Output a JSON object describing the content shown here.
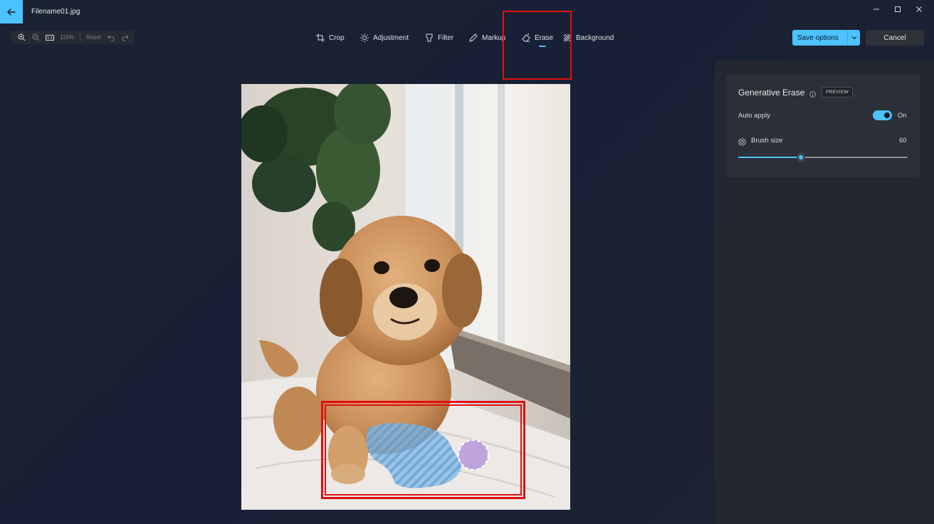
{
  "titlebar": {
    "filename": "Filename01.jpg",
    "icons": [
      "back-arrow-icon",
      "minimize-icon",
      "maximize-icon",
      "close-icon"
    ]
  },
  "zoom": {
    "level": "110%",
    "reset_label": "Reset",
    "icons": [
      "zoom-in-icon",
      "zoom-out-icon",
      "actual-size-icon",
      "undo-icon",
      "redo-icon"
    ]
  },
  "toolbar": {
    "active_tool": "Erase",
    "tools": [
      {
        "label": "Crop",
        "icon": "crop-icon"
      },
      {
        "label": "Adjustment",
        "icon": "brightness-icon"
      },
      {
        "label": "Filter",
        "icon": "filter-icon"
      },
      {
        "label": "Markup",
        "icon": "pen-icon"
      },
      {
        "label": "Erase",
        "icon": "eraser-icon"
      },
      {
        "label": "Background",
        "icon": "background-icon"
      }
    ],
    "save_label": "Save options",
    "cancel_label": "Cancel"
  },
  "panel": {
    "title": "Generative Erase",
    "badge": "PREVIEW",
    "auto_apply_label": "Auto apply",
    "auto_apply_state": "On",
    "auto_apply_on": true,
    "brush_label": "Brush size",
    "brush_value": "60",
    "brush_fraction": 0.37
  },
  "colors": {
    "accent": "#4cc2ff",
    "highlight": "#e01010",
    "erase_mask": "#7ab8e8"
  }
}
